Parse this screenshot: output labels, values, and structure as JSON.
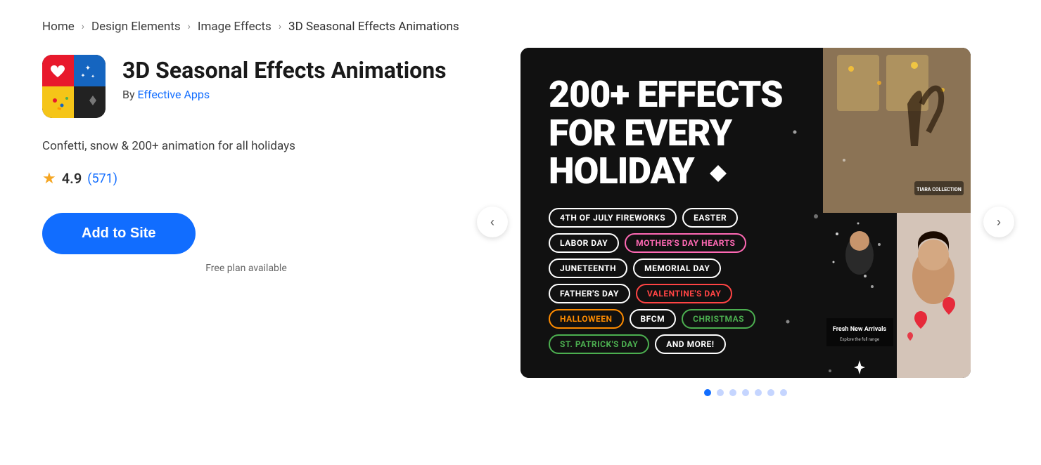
{
  "breadcrumb": {
    "items": [
      {
        "label": "Home",
        "href": "#"
      },
      {
        "label": "Design Elements",
        "href": "#"
      },
      {
        "label": "Image Effects",
        "href": "#"
      },
      {
        "label": "3D Seasonal Effects Animations",
        "href": null
      }
    ],
    "separators": [
      "›",
      "›",
      "›"
    ]
  },
  "app": {
    "title": "3D Seasonal Effects Animations",
    "author_prefix": "By",
    "author_name": "Effective Apps",
    "description": "Confetti, snow & 200+ animation for all holidays",
    "rating": "4.9",
    "rating_count": "(571)",
    "add_to_site_label": "Add to Site",
    "free_plan_label": "Free plan available"
  },
  "promo": {
    "headline_line1": "200+ EFFECTS",
    "headline_line2": "FOR EVERY",
    "headline_line3": "HOLIDAY",
    "tags": [
      {
        "label": "4TH OF JULY FIREWORKS",
        "color": "white"
      },
      {
        "label": "EASTER",
        "color": "white"
      },
      {
        "label": "LABOR DAY",
        "color": "white"
      },
      {
        "label": "MOTHER'S DAY HEARTS",
        "color": "pink"
      },
      {
        "label": "JUNETEENTH",
        "color": "white"
      },
      {
        "label": "MEMORIAL DAY",
        "color": "white"
      },
      {
        "label": "FATHER'S DAY",
        "color": "white"
      },
      {
        "label": "VALENTINE'S DAY",
        "color": "red"
      },
      {
        "label": "HALLOWEEN",
        "color": "orange"
      },
      {
        "label": "BFCM",
        "color": "white"
      },
      {
        "label": "CHRISTMAS",
        "color": "green"
      },
      {
        "label": "ST. PATRICK'S DAY",
        "color": "green"
      },
      {
        "label": "AND MORE!",
        "color": "white"
      }
    ]
  },
  "carousel": {
    "total_slides": 7,
    "active_slide": 0,
    "nav_left_label": "‹",
    "nav_right_label": "›"
  },
  "colors": {
    "primary": "#116dff",
    "star": "#f5a623",
    "text_dark": "#1a1a1a",
    "text_medium": "#3d3d3d",
    "text_light": "#666"
  }
}
